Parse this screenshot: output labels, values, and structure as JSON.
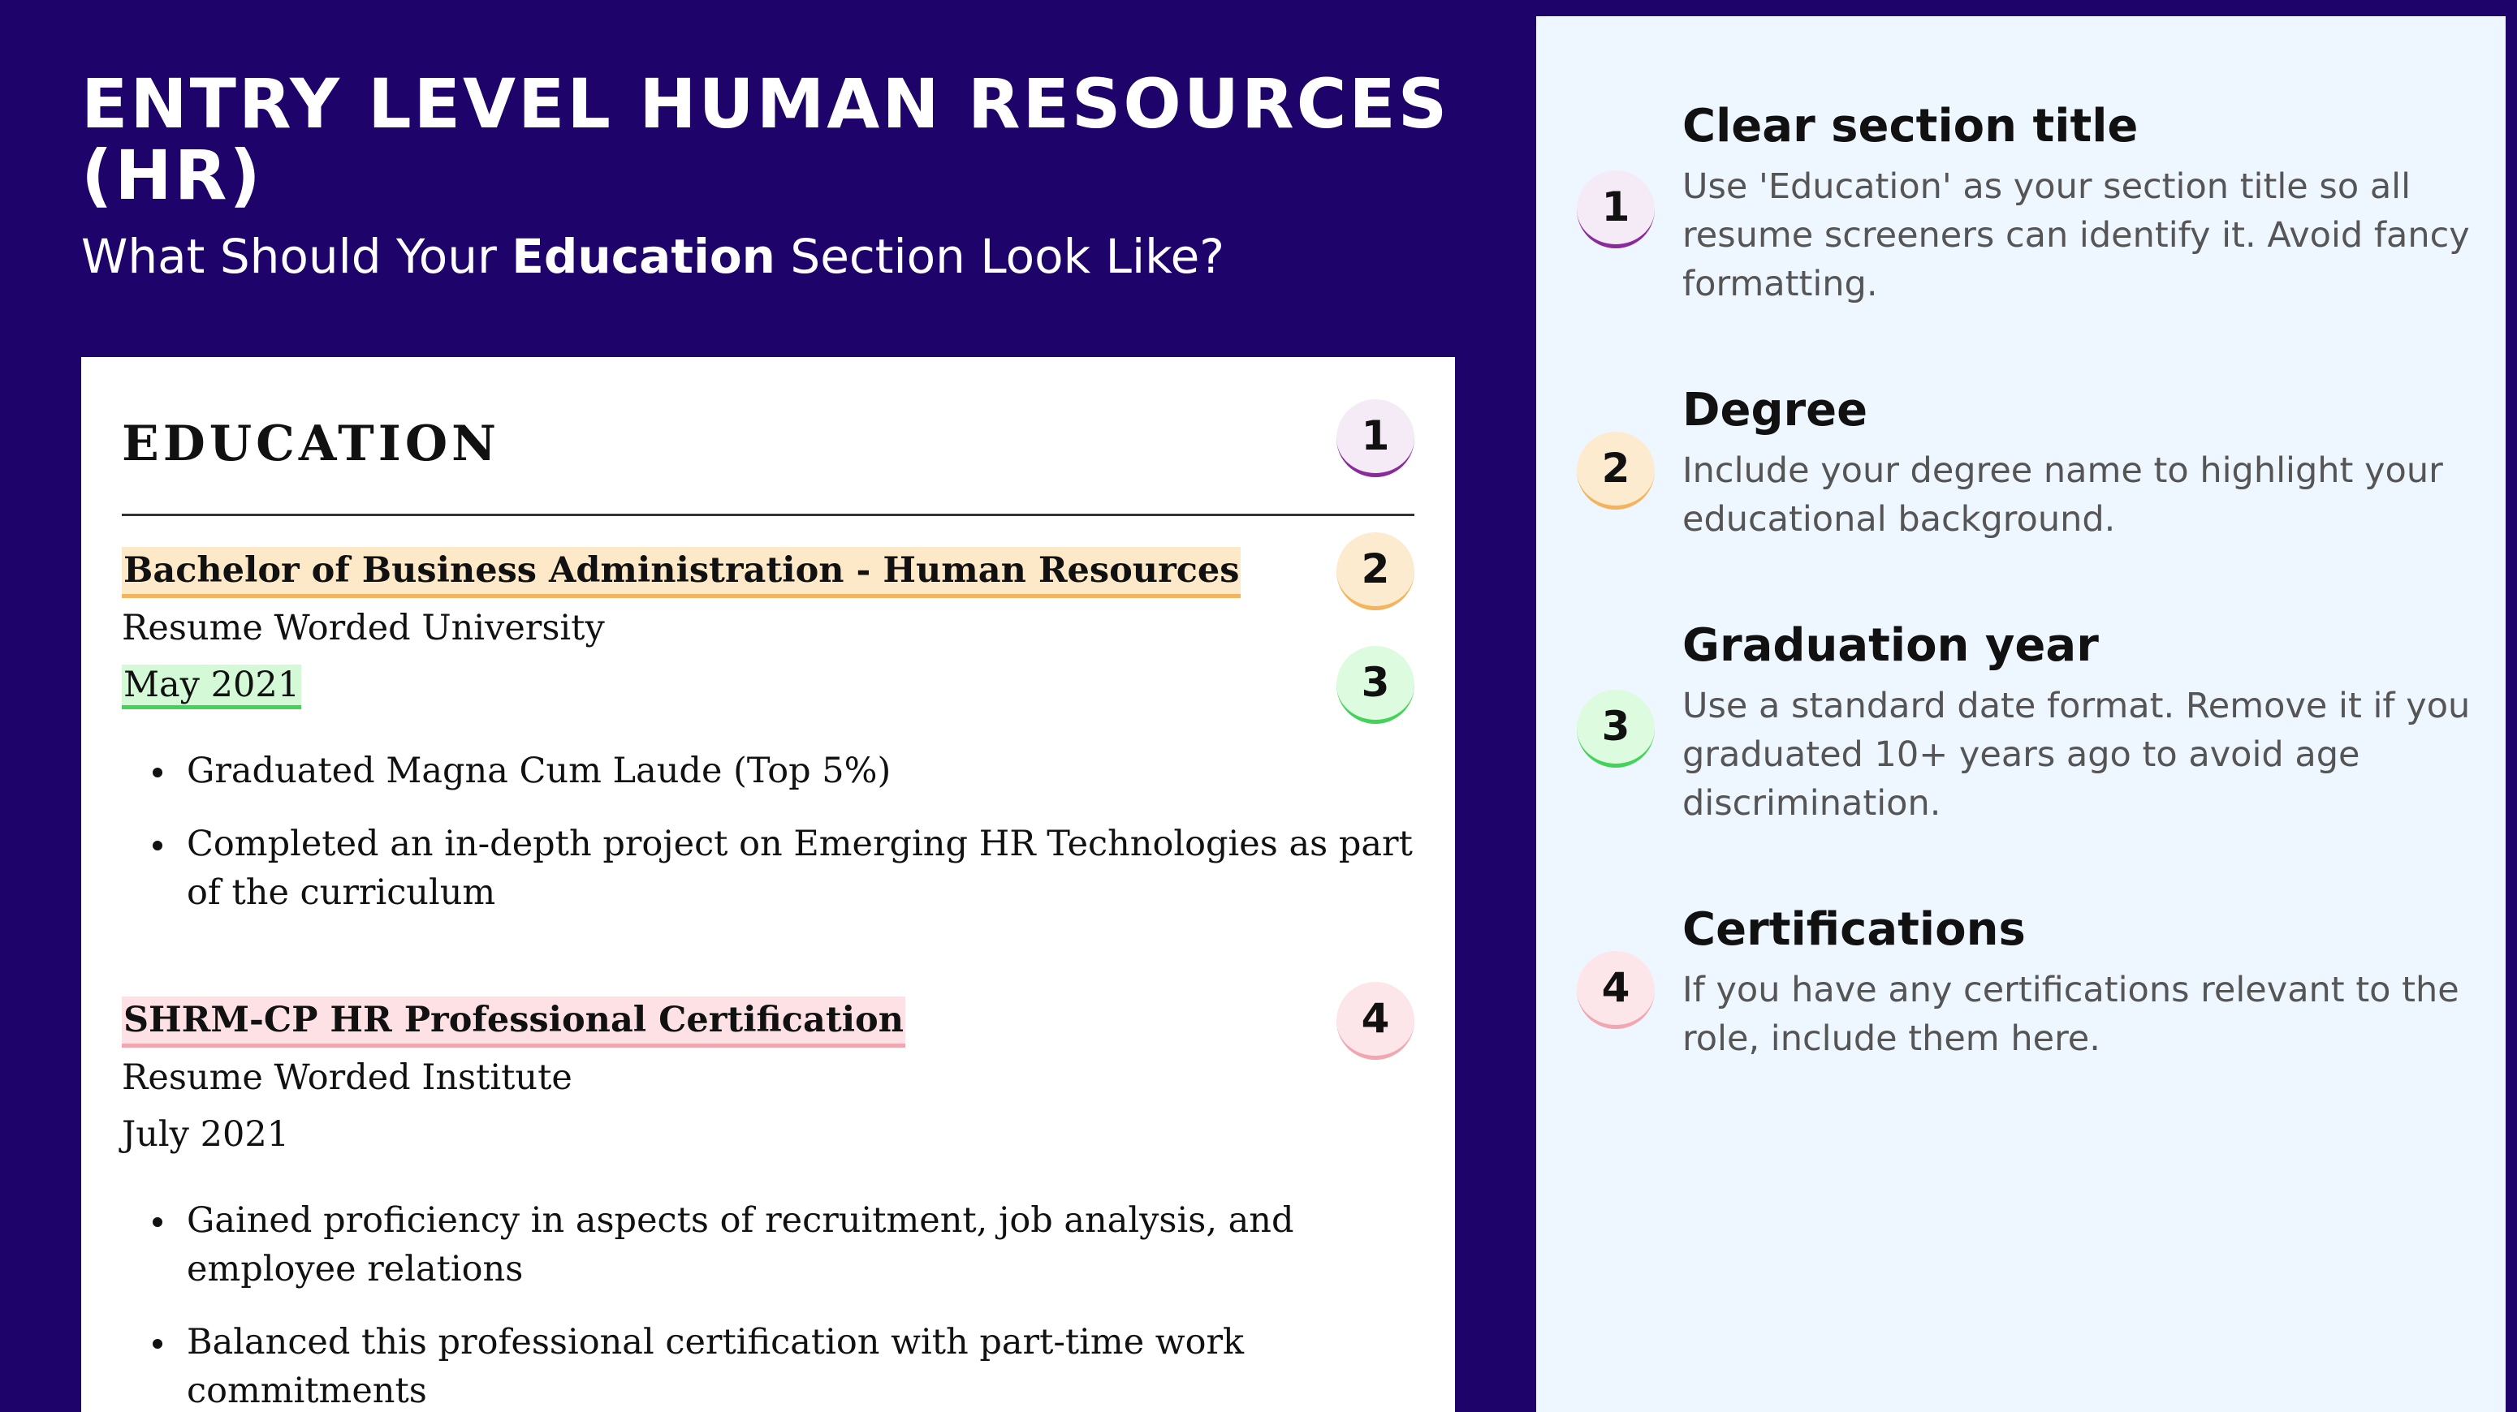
{
  "header": {
    "title": "ENTRY LEVEL HUMAN RESOURCES (HR)",
    "subtitle_prefix": "What Should Your ",
    "subtitle_emphasis": "Education",
    "subtitle_suffix": " Section Look Like?"
  },
  "resume": {
    "section_title": "EDUCATION",
    "entries": [
      {
        "title": "Bachelor of Business Administration - Human Resources",
        "institution": "Resume Worded University",
        "date": "May 2021",
        "bullets": [
          "Graduated Magna Cum Laude (Top 5%)",
          "Completed an in-depth project on Emerging HR Technologies as part of the curriculum"
        ]
      },
      {
        "title": "SHRM-CP HR Professional Certification",
        "institution": "Resume Worded Institute",
        "date": "July 2021",
        "bullets": [
          "Gained proficiency in aspects of recruitment, job analysis, and employee relations",
          "Balanced this professional certification with part-time work commitments"
        ]
      }
    ],
    "badges": [
      "1",
      "2",
      "3",
      "4"
    ]
  },
  "tips": [
    {
      "number": "1",
      "title": "Clear section title",
      "text": "Use 'Education' as your section title so all resume screeners can identify it. Avoid fancy formatting."
    },
    {
      "number": "2",
      "title": "Degree",
      "text": "Include your degree name to highlight your educational background."
    },
    {
      "number": "3",
      "title": "Graduation year",
      "text": "Use a standard date format. Remove it if you graduated 10+ years ago to avoid age discrimination."
    },
    {
      "number": "4",
      "title": "Certifications",
      "text": "If you have any certifications relevant to the role, include them here."
    }
  ],
  "colors": {
    "background": "#1e046a",
    "panel": "#eef6ff",
    "badge_1_accent": "#8a2a9c",
    "badge_2_accent": "#f3b45d",
    "badge_3_accent": "#44d35a",
    "badge_4_accent": "#f2a6b0"
  }
}
